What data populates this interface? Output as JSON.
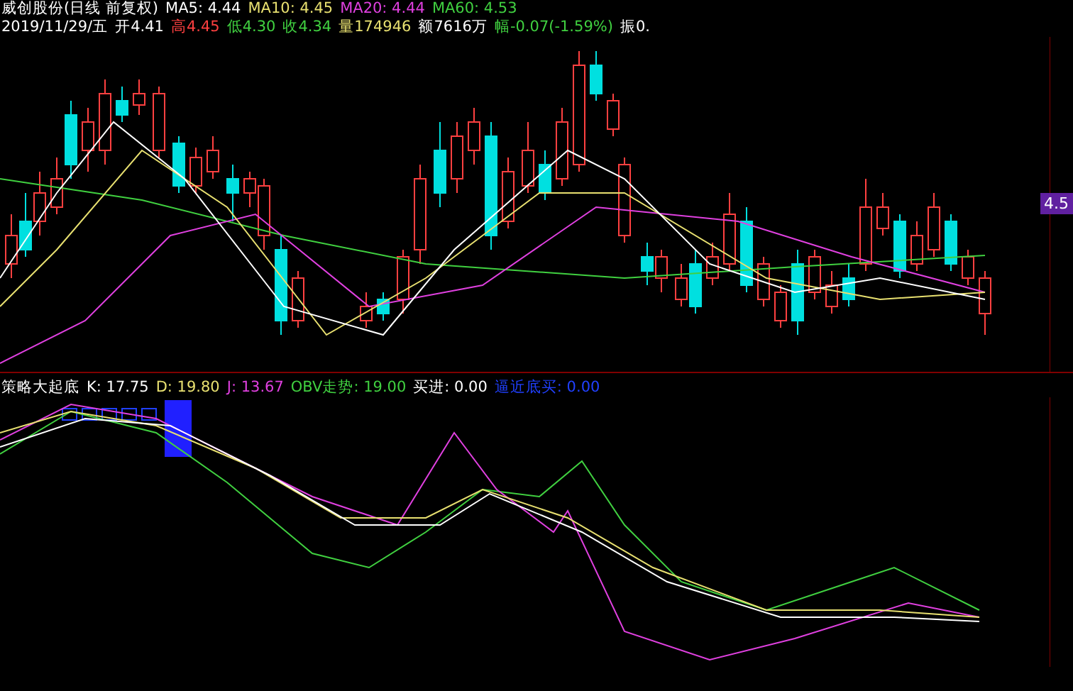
{
  "header": {
    "title": "威创股份(日线 前复权)",
    "ma": [
      {
        "label": "MA5: 4.44",
        "color": "#ffffff"
      },
      {
        "label": "MA10: 4.45",
        "color": "#e8e070"
      },
      {
        "label": "MA20: 4.44",
        "color": "#e040e0"
      },
      {
        "label": "MA60: 4.53",
        "color": "#40d040"
      }
    ]
  },
  "quote": [
    {
      "label": "2019/11/29/五",
      "color": "#ffffff"
    },
    {
      "label": "开4.41",
      "color": "#ffffff"
    },
    {
      "label": "高4.45",
      "color": "#ff4040"
    },
    {
      "label": "低4.30",
      "color": "#40d040"
    },
    {
      "label": "收4.34",
      "color": "#40d040"
    },
    {
      "label": "量174946",
      "color": "#e8e070"
    },
    {
      "label": "额7616万",
      "color": "#ffffff"
    },
    {
      "label": "幅-0.07(-1.59%)",
      "color": "#40d040"
    },
    {
      "label": "振0.",
      "color": "#ffffff"
    }
  ],
  "price_label": "4.5",
  "indicator": {
    "title": "策略大起底",
    "values": [
      {
        "label": "K: 17.75",
        "color": "#ffffff"
      },
      {
        "label": "D: 19.80",
        "color": "#e8e070"
      },
      {
        "label": "J: 13.67",
        "color": "#e040e0"
      },
      {
        "label": "OBV走势: 19.00",
        "color": "#40d040"
      },
      {
        "label": "买进: 0.00",
        "color": "#ffffff"
      },
      {
        "label": "逼近底买: 0.00",
        "color": "#2040ff"
      }
    ]
  }
}
